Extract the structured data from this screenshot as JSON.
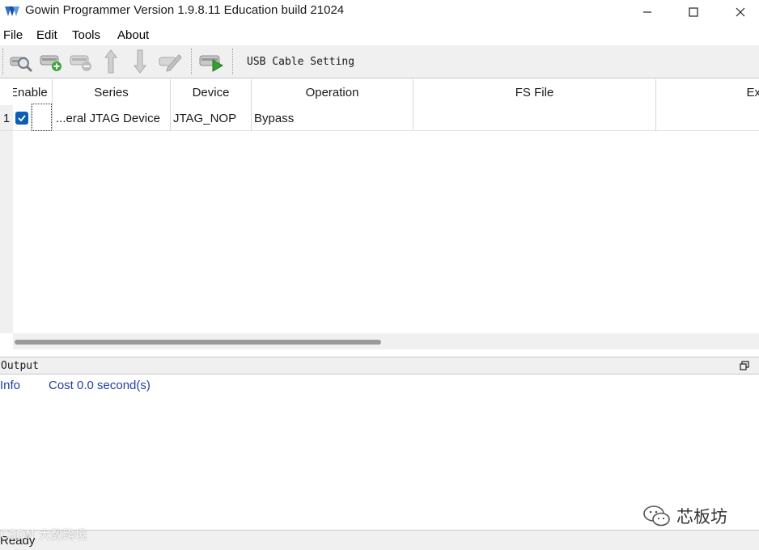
{
  "window": {
    "title": "Gowin Programmer Version 1.9.8.11 Education build 21024"
  },
  "menu": {
    "items": [
      "File",
      "Edit",
      "Tools",
      "About"
    ]
  },
  "toolbar": {
    "icons": [
      "scan-device-icon",
      "add-device-icon",
      "remove-device-icon",
      "move-up-icon",
      "move-down-icon",
      "edit-icon",
      "program-run-icon"
    ],
    "cable_setting_label": "USB Cable Setting"
  },
  "device_table": {
    "columns": [
      "Enable",
      "Series",
      "Device",
      "Operation",
      "FS File",
      "Ex"
    ],
    "rows": [
      {
        "index": "1",
        "enabled": true,
        "series": "...eral JTAG Device",
        "device": "JTAG_NOP",
        "operation": "Bypass",
        "fs_file": ""
      }
    ]
  },
  "output": {
    "title": "Output",
    "logs": [
      {
        "level": "Info",
        "message": "Cost 0.0 second(s)"
      }
    ]
  },
  "status": {
    "text": "Ready"
  },
  "watermarks": {
    "right": "芯板坊",
    "left": "CSDN 大数跨境"
  },
  "colors": {
    "accent_blue": "#0a5fb4",
    "log_text": "#1f3fa8",
    "chrome_bg": "#f0f0f0"
  }
}
